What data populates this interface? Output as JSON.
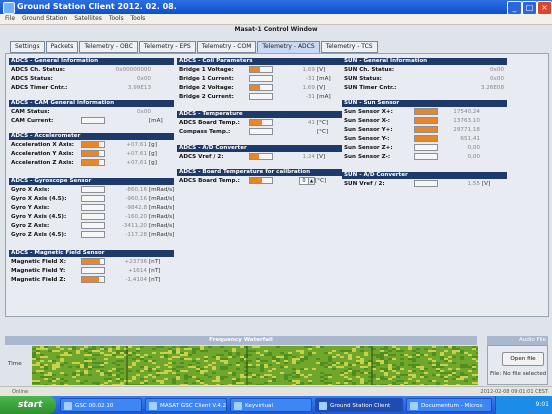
{
  "window": {
    "title": "Ground Station Client  2012. 02. 08.",
    "btn_min": "_",
    "btn_max": "□",
    "btn_close": "×"
  },
  "menu": [
    "File",
    "Ground Station",
    "Satellites",
    "Tools",
    "Tools"
  ],
  "panel_title": "Masat-1 Control Window",
  "tabs": [
    "Settings",
    "Packets",
    "Telemetry - OBC",
    "Telemetry - EPS",
    "Telemetry - COM",
    "Telemetry - ADCS",
    "Telemetry - TCS"
  ],
  "active_tab": 5,
  "sections": {
    "adcs_general": {
      "title": "ADCS - General Information",
      "rows": [
        {
          "label": "ADCS Ch. Status:",
          "value": "0x00000000",
          "unit": ""
        },
        {
          "label": "ADCS Status:",
          "value": "0x00",
          "unit": ""
        },
        {
          "label": "ADCS Timer Cntr.:",
          "value": "3.99E13",
          "unit": ""
        }
      ]
    },
    "adcs_cam": {
      "title": "ADCS - CAM General Information",
      "rows": [
        {
          "label": "CAM Status:",
          "value": "0x00",
          "unit": ""
        },
        {
          "label": "CAM Current:",
          "value": "",
          "unit": "[mA]",
          "fill": 0.0
        }
      ]
    },
    "adcs_acc": {
      "title": "ADCS - Accelerometer",
      "rows": [
        {
          "label": "Acceleration X Axis:",
          "value": "+07,61",
          "unit": "[g]",
          "fill": 0.75
        },
        {
          "label": "Acceleration Y Axis:",
          "value": "+07,61",
          "unit": "[g]",
          "fill": 0.75
        },
        {
          "label": "Acceleration Z Axis:",
          "value": "+07,61",
          "unit": "[g]",
          "fill": 0.75
        }
      ]
    },
    "adcs_gyro": {
      "title": "ADCS - Gyroscope Sensor",
      "rows": [
        {
          "label": "Gyro X Axis:",
          "value": "-860,16",
          "unit": "[mRad/s]",
          "fill": 0.0
        },
        {
          "label": "Gyro X Axis (4.5):",
          "value": "-960,16",
          "unit": "[mRad/s]",
          "fill": 0.0
        },
        {
          "label": "Gyro Y Axis:",
          "value": "-9842,8",
          "unit": "[mRad/s]",
          "fill": 0.0
        },
        {
          "label": "Gyro Y Axis (4.5):",
          "value": "-160,20",
          "unit": "[mRad/s]",
          "fill": 0.0
        },
        {
          "label": "Gyro Z Axis:",
          "value": "-3411,20",
          "unit": "[mRad/s]",
          "fill": 0.0
        },
        {
          "label": "Gyro Z Axis (4.5):",
          "value": "-117,28",
          "unit": "[mRad/s]",
          "fill": 0.0
        }
      ]
    },
    "adcs_mag": {
      "title": "ADCS - Magnetic Field Sensor",
      "rows": [
        {
          "label": "Magnetic Field X:",
          "value": "+23736",
          "unit": "[nT]",
          "fill": 0.8
        },
        {
          "label": "Magnetic Field Y:",
          "value": "+1614",
          "unit": "[nT]",
          "fill": 0.0
        },
        {
          "label": "Magnetic Field Z:",
          "value": "-1,4104",
          "unit": "[nT]",
          "fill": 0.75
        }
      ]
    },
    "adcs_coil": {
      "title": "ADCS - Coil Parameters",
      "rows": [
        {
          "label": "Bridge 1 Voltage:",
          "value": "1,69",
          "unit": "[V]",
          "fill": 0.45
        },
        {
          "label": "Bridge 1 Current:",
          "value": "-31",
          "unit": "[mA]",
          "fill": 0.0
        },
        {
          "label": "Bridge 2 Voltage:",
          "value": "1,69",
          "unit": "[V]",
          "fill": 0.45
        },
        {
          "label": "Bridge 2 Current:",
          "value": "-31",
          "unit": "[mA]",
          "fill": 0.0
        }
      ]
    },
    "adcs_temp": {
      "title": "ADCS - Temperature",
      "rows": [
        {
          "label": "ADCS Board Temp.:",
          "value": "41",
          "unit": "[°C]",
          "fill": 0.55
        },
        {
          "label": "Compass Temp.:",
          "value": "",
          "unit": "[°C]",
          "fill": 0.0
        }
      ]
    },
    "adcs_ad": {
      "title": "ADCS - A/D Converter",
      "rows": [
        {
          "label": "ADCS Vref / 2:",
          "value": "1,24",
          "unit": "[V]",
          "fill": 0.4
        }
      ]
    },
    "adcs_cal": {
      "title": "ADCS - Board Temperature for calibration",
      "rows": [
        {
          "label": "ADCS Board Temp.:",
          "value": "0",
          "unit": "[°C]",
          "fill": 0.55
        }
      ]
    },
    "sun_general": {
      "title": "SUN - General Information",
      "rows": [
        {
          "label": "SUN Ch. Status:",
          "value": "0x00",
          "unit": ""
        },
        {
          "label": "SUN Status:",
          "value": "0x00",
          "unit": ""
        },
        {
          "label": "SUN Timer Cntr.:",
          "value": "3.26E08",
          "unit": ""
        }
      ]
    },
    "sun_sensor": {
      "title": "SUN - Sun Sensor",
      "rows": [
        {
          "label": "Sun Sensor X+:",
          "value": "17540,24",
          "unit": "",
          "fill": 1.0
        },
        {
          "label": "Sun Sensor X-:",
          "value": "13763,10",
          "unit": "",
          "fill": 1.0
        },
        {
          "label": "Sun Sensor Y+:",
          "value": "29771,18",
          "unit": "",
          "fill": 1.0
        },
        {
          "label": "Sun Sensor Y-:",
          "value": "651,41",
          "unit": "",
          "fill": 1.0
        },
        {
          "label": "Sun Sensor Z+:",
          "value": "0,00",
          "unit": "",
          "fill": 0.0
        },
        {
          "label": "Sun Sensor Z-:",
          "value": "0,00",
          "unit": "",
          "fill": 0.0
        }
      ]
    },
    "sun_ad": {
      "title": "SUN - A/D Converter",
      "rows": [
        {
          "label": "SUN Vref / 2:",
          "value": "1,55",
          "unit": "[V]",
          "fill": 0.0
        }
      ]
    }
  },
  "waterfall": {
    "title": "Frequency Waterfall",
    "time_label": "Time"
  },
  "audio": {
    "title": "Audio File",
    "open_button": "Open file",
    "file_status": "File: No file selected"
  },
  "statusbar": {
    "left": "Online",
    "right": "2012-02-08 09:01:01 CEST"
  },
  "taskbar": {
    "start": "start",
    "tasks": [
      {
        "label": "GSC 00.02.10",
        "active": false
      },
      {
        "label": "MASAT GSC Client V.4.2",
        "active": false
      },
      {
        "label": "Keyvirtual",
        "active": false
      },
      {
        "label": "Ground Station Client",
        "active": true
      },
      {
        "label": "Documentum - Micros",
        "active": false
      }
    ],
    "clock": "9:01"
  },
  "colors": {
    "accent": "#1e3a6b",
    "bar_fill": "#e8872a",
    "waterfall_green": "#6fa72c",
    "waterfall_yellow": "#c9d24a"
  }
}
